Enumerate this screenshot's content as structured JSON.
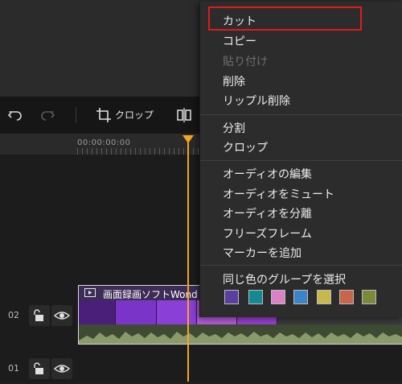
{
  "toolbar": {
    "undo_icon": "undo-icon",
    "redo_icon": "redo-icon",
    "crop_icon": "crop-icon",
    "crop_label": "クロップ",
    "split_icon": "split-icon"
  },
  "ruler": {
    "timecode": "00:00:00:00"
  },
  "tracks": [
    {
      "number": "02"
    },
    {
      "number": "01"
    }
  ],
  "clip": {
    "title": "画面録画ソフトWond"
  },
  "menu": {
    "items": [
      {
        "label": "カット",
        "enabled": true,
        "highlighted": true
      },
      {
        "label": "コピー",
        "enabled": true
      },
      {
        "label": "貼り付け",
        "enabled": false
      },
      {
        "label": "削除",
        "enabled": true
      },
      {
        "label": "リップル削除",
        "enabled": true
      },
      {
        "label": "分割",
        "enabled": true
      },
      {
        "label": "クロップ",
        "enabled": true
      },
      {
        "label": "オーディオの編集",
        "enabled": true
      },
      {
        "label": "オーディオをミュート",
        "enabled": true
      },
      {
        "label": "オーディオを分離",
        "enabled": true
      },
      {
        "label": "フリーズフレーム",
        "enabled": true
      },
      {
        "label": "マーカーを追加",
        "enabled": true
      },
      {
        "label": "同じ色のグループを選択",
        "enabled": true
      }
    ],
    "color_swatches": [
      "#5b3fa0",
      "#138a93",
      "#d982c8",
      "#3a86c8",
      "#c8b84a",
      "#c8654a",
      "#7a8a3a"
    ]
  },
  "colors": {
    "playhead": "#f5a623",
    "highlight": "#e01b1b"
  }
}
